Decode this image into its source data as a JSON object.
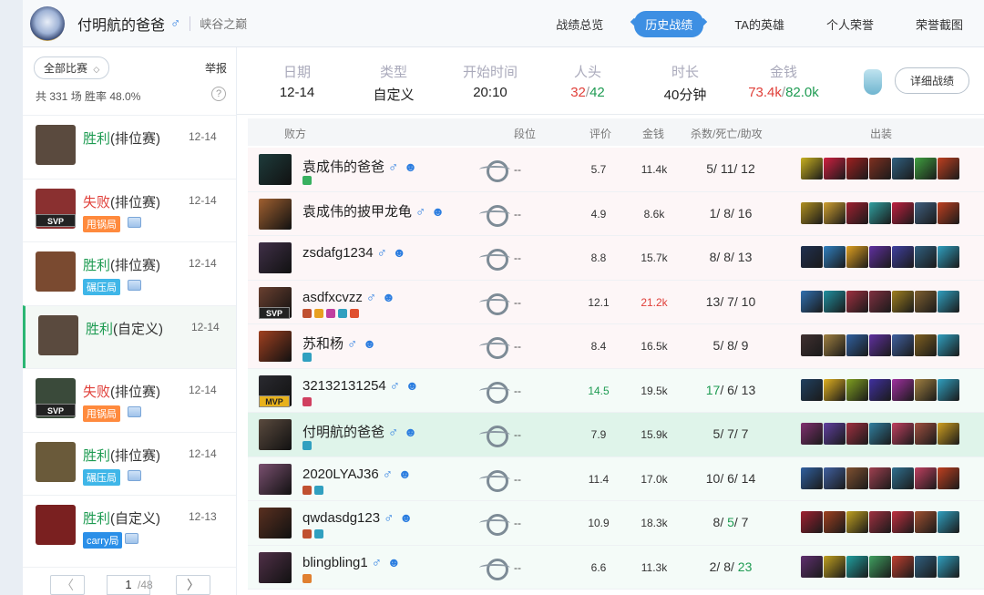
{
  "header": {
    "player_name": "付明航的爸爸",
    "sex_symbol": "♂",
    "server": "峡谷之巅",
    "nav": [
      "战绩总览",
      "历史战绩",
      "TA的英雄",
      "个人荣誉",
      "荣誉截图"
    ],
    "active_nav": "历史战绩"
  },
  "sidebar": {
    "filter_label": "全部比赛",
    "filter_chevron": "◇",
    "report_label": "举报",
    "stats": "共 331 场   胜率 48.0%",
    "help": "?",
    "games": [
      {
        "result": "胜利",
        "type": "(排位赛)",
        "date": "12-14",
        "outcome": "win",
        "tag": "",
        "badge": "",
        "badge_color": "",
        "avatar": "#5a4a3e"
      },
      {
        "result": "失败",
        "type": "(排位赛)",
        "date": "12-14",
        "outcome": "lose",
        "tag": "SVP",
        "badge": "甩锅局",
        "badge_color": "#ff8a3d",
        "avatar": "#8a3030"
      },
      {
        "result": "胜利",
        "type": "(排位赛)",
        "date": "12-14",
        "outcome": "win",
        "tag": "",
        "badge": "碾压局",
        "badge_color": "#3fb6e8",
        "avatar": "#7a4a30"
      },
      {
        "result": "胜利",
        "type": "(自定义)",
        "date": "12-14",
        "outcome": "win",
        "tag": "",
        "badge": "",
        "badge_color": "",
        "avatar": "#5a4a3e"
      },
      {
        "result": "失败",
        "type": "(排位赛)",
        "date": "12-14",
        "outcome": "lose",
        "tag": "SVP",
        "badge": "甩锅局",
        "badge_color": "#ff8a3d",
        "avatar": "#3a4a3a"
      },
      {
        "result": "胜利",
        "type": "(排位赛)",
        "date": "12-14",
        "outcome": "win",
        "tag": "",
        "badge": "碾压局",
        "badge_color": "#3fb6e8",
        "avatar": "#6a5a3a"
      },
      {
        "result": "胜利",
        "type": "(自定义)",
        "date": "12-13",
        "outcome": "win",
        "tag": "",
        "badge": "carry局",
        "badge_color": "#2b8fe8",
        "avatar": "#7a2020"
      }
    ],
    "pager": {
      "prev": "〈",
      "next": "〉",
      "page": "1",
      "total": "/48"
    }
  },
  "summary": {
    "date_label": "日期",
    "date": "12-14",
    "type_label": "类型",
    "type": "自定义",
    "start_label": "开始时间",
    "start": "20:10",
    "kills_label": "人头",
    "kills_red": "32",
    "kills_sep": "/",
    "kills_green": "42",
    "duration_label": "时长",
    "duration": "40分钟",
    "gold_label": "金钱",
    "gold_red": "73.4k",
    "gold_sep": "/",
    "gold_green": "82.0k",
    "detail_button": "详细战绩"
  },
  "table": {
    "headers": {
      "team": "败方",
      "rank": "段位",
      "score": "评价",
      "gold": "金钱",
      "kda": "杀数/死亡/助攻",
      "items": "出装"
    },
    "players": [
      {
        "name": "袁成伟的爸爸",
        "rank": "--",
        "score": "5.7",
        "gold": "11.4k",
        "k": "5",
        "d": "11",
        "a": "12",
        "team": "defeat",
        "tag": "",
        "avatar": "#1e3c3c",
        "medals": [
          "#38b060"
        ],
        "highlight": ""
      },
      {
        "name": "袁成伟的披甲龙龟",
        "rank": "--",
        "score": "4.9",
        "gold": "8.6k",
        "k": "1",
        "d": "8",
        "a": "16",
        "team": "defeat",
        "tag": "",
        "avatar": "#a06030",
        "medals": [],
        "highlight": ""
      },
      {
        "name": "zsdafg1234",
        "rank": "--",
        "score": "8.8",
        "gold": "15.7k",
        "k": "8",
        "d": "8",
        "a": "13",
        "team": "defeat",
        "tag": "",
        "avatar": "#403048",
        "medals": [],
        "highlight": ""
      },
      {
        "name": "asdfxcvzz",
        "rank": "--",
        "score": "12.1",
        "gold": "21.2k",
        "k": "13",
        "d": "7",
        "a": "10",
        "team": "defeat",
        "tag": "SVP",
        "avatar": "#6a4030",
        "medals": [
          "#c05030",
          "#e8a020",
          "#c040a0",
          "#30a0c0",
          "#e05030"
        ],
        "highlight": "gold"
      },
      {
        "name": "苏和杨",
        "rank": "--",
        "score": "8.4",
        "gold": "16.5k",
        "k": "5",
        "d": "8",
        "a": "9",
        "team": "defeat",
        "tag": "",
        "avatar": "#a04020",
        "medals": [
          "#30a0c0"
        ],
        "highlight": ""
      },
      {
        "name": "32132131254",
        "rank": "--",
        "score": "14.5",
        "gold": "19.5k",
        "k": "17",
        "d": "6",
        "a": "13",
        "team": "victory",
        "tag": "MVP",
        "avatar": "#2a2a30",
        "medals": [
          "#d04060"
        ],
        "highlight": "score"
      },
      {
        "name": "付明航的爸爸",
        "rank": "--",
        "score": "7.9",
        "gold": "15.9k",
        "k": "5",
        "d": "7",
        "a": "7",
        "team": "me",
        "tag": "",
        "avatar": "#5a4a3e",
        "medals": [
          "#30a0c0"
        ],
        "highlight": ""
      },
      {
        "name": "2020LYAJ36",
        "rank": "--",
        "score": "11.4",
        "gold": "17.0k",
        "k": "10",
        "d": "6",
        "a": "14",
        "team": "victory",
        "tag": "",
        "avatar": "#7a5070",
        "medals": [
          "#c05030",
          "#30a0c0"
        ],
        "highlight": ""
      },
      {
        "name": "qwdasdg123",
        "rank": "--",
        "score": "10.9",
        "gold": "18.3k",
        "k": "8",
        "d": "5",
        "a": "7",
        "team": "victory",
        "tag": "",
        "avatar": "#5a3020",
        "medals": [
          "#c05030",
          "#30a0c0"
        ],
        "highlight": "deaths"
      },
      {
        "name": "blingbling1",
        "rank": "--",
        "score": "6.6",
        "gold": "11.3k",
        "k": "2",
        "d": "8",
        "a": "23",
        "team": "victory",
        "tag": "",
        "avatar": "#503048",
        "medals": [
          "#e08030"
        ],
        "highlight": "assists"
      }
    ],
    "item_colors": [
      [
        "#c8b020",
        "#d02040",
        "#a02020",
        "#803020",
        "#306080",
        "#40a040",
        "#c04020"
      ],
      [
        "#b09020",
        "#d0a030",
        "#a02030",
        "#30a0a0",
        "#c02040",
        "#406080",
        "#c04020"
      ],
      [
        "#203050",
        "#3080c0",
        "#e0a020",
        "#6030a0",
        "#4040a0",
        "#306080",
        "#30a0c0"
      ],
      [
        "#3070b0",
        "#2090a0",
        "#a03040",
        "#803040",
        "#a08020",
        "#806030",
        "#30a0c0"
      ],
      [
        "#403030",
        "#a08040",
        "#3060a0",
        "#6030a0",
        "#4060a0",
        "#806020",
        "#30a0c0"
      ],
      [
        "#204060",
        "#e0b020",
        "#80a020",
        "#4030a0",
        "#a030a0",
        "#a08040",
        "#30a0c0"
      ],
      [
        "#803070",
        "#6040a0",
        "#a03040",
        "#3080a0",
        "#c04060",
        "#a05040",
        "#d0a020"
      ],
      [
        "#3060a0",
        "#4060a0",
        "#805030",
        "#a04050",
        "#307090",
        "#c04060",
        "#c04020"
      ],
      [
        "#a02030",
        "#a04020",
        "#c0a020",
        "#a03040",
        "#c03040",
        "#a05030",
        "#30a0c0"
      ],
      [
        "#603070",
        "#c0a020",
        "#20a0a0",
        "#40a060",
        "#c04030",
        "#306080",
        "#30a0c0"
      ]
    ]
  }
}
